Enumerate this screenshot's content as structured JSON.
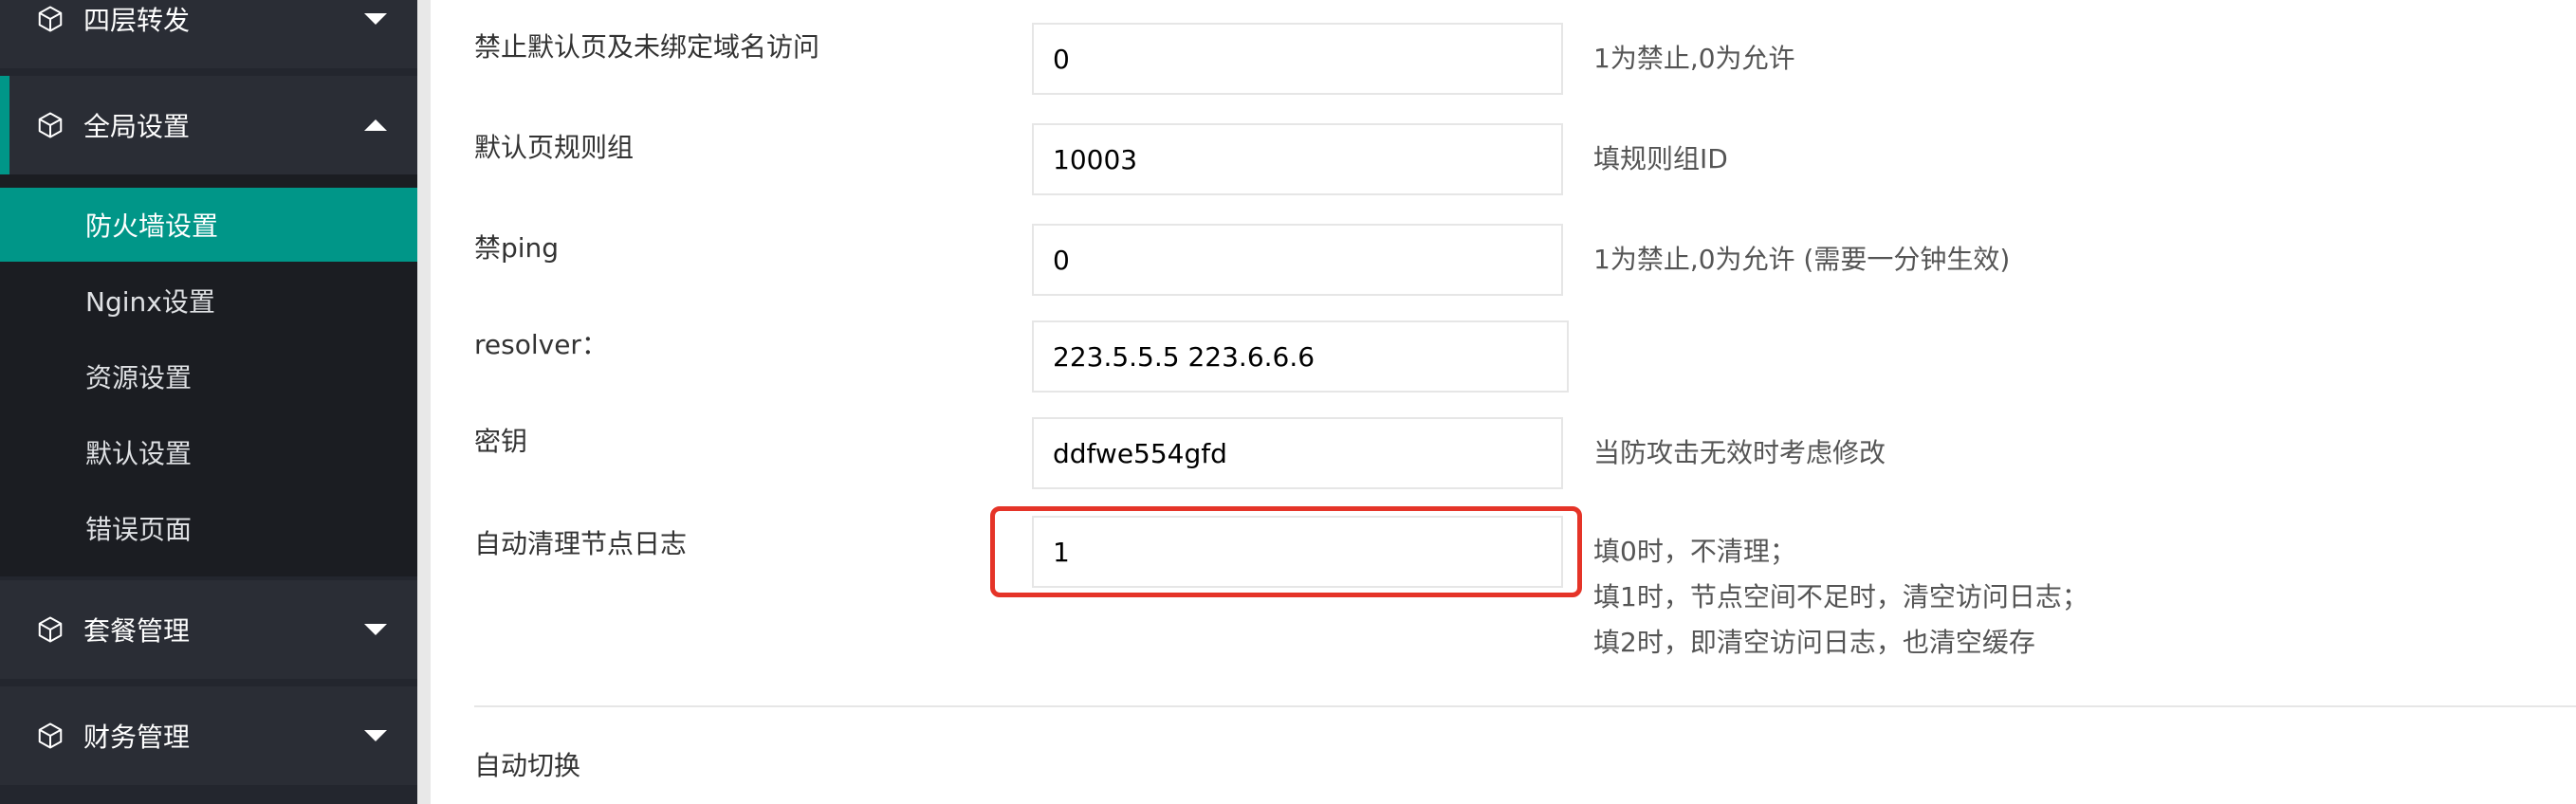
{
  "sidebar": {
    "groups": [
      {
        "label": "四层转发",
        "expanded": false
      },
      {
        "label": "全局设置",
        "expanded": true
      },
      {
        "label": "套餐管理",
        "expanded": false
      },
      {
        "label": "财务管理",
        "expanded": false
      }
    ],
    "sub_items": [
      {
        "label": "防火墙设置",
        "active": true
      },
      {
        "label": "Nginx设置",
        "active": false
      },
      {
        "label": "资源设置",
        "active": false
      },
      {
        "label": "默认设置",
        "active": false
      },
      {
        "label": "错误页面",
        "active": false
      }
    ],
    "accent_color": "#009688"
  },
  "form": {
    "rows": [
      {
        "label": "禁止默认页及未绑定域名访问",
        "value": "0",
        "hint": "1为禁止,0为允许"
      },
      {
        "label": "默认页规则组",
        "value": "10003",
        "hint": "填规则组ID"
      },
      {
        "label": "禁ping",
        "value": "0",
        "hint": "1为禁止,0为允许 (需要一分钟生效)"
      },
      {
        "label": "resolver：",
        "value": "223.5.5.5 223.6.6.6",
        "hint": ""
      },
      {
        "label": "密钥",
        "value": "ddfwe554gfd",
        "hint": "当防攻击无效时考虑修改"
      },
      {
        "label": "自动清理节点日志",
        "value": "1",
        "hint_lines": [
          "填0时，不清理；",
          "填1时，节点空间不足时，清空访问日志；",
          "填2时，即清空访问日志，也清空缓存"
        ]
      }
    ],
    "section_title": "自动切换",
    "highlight_color": "#e53428"
  }
}
